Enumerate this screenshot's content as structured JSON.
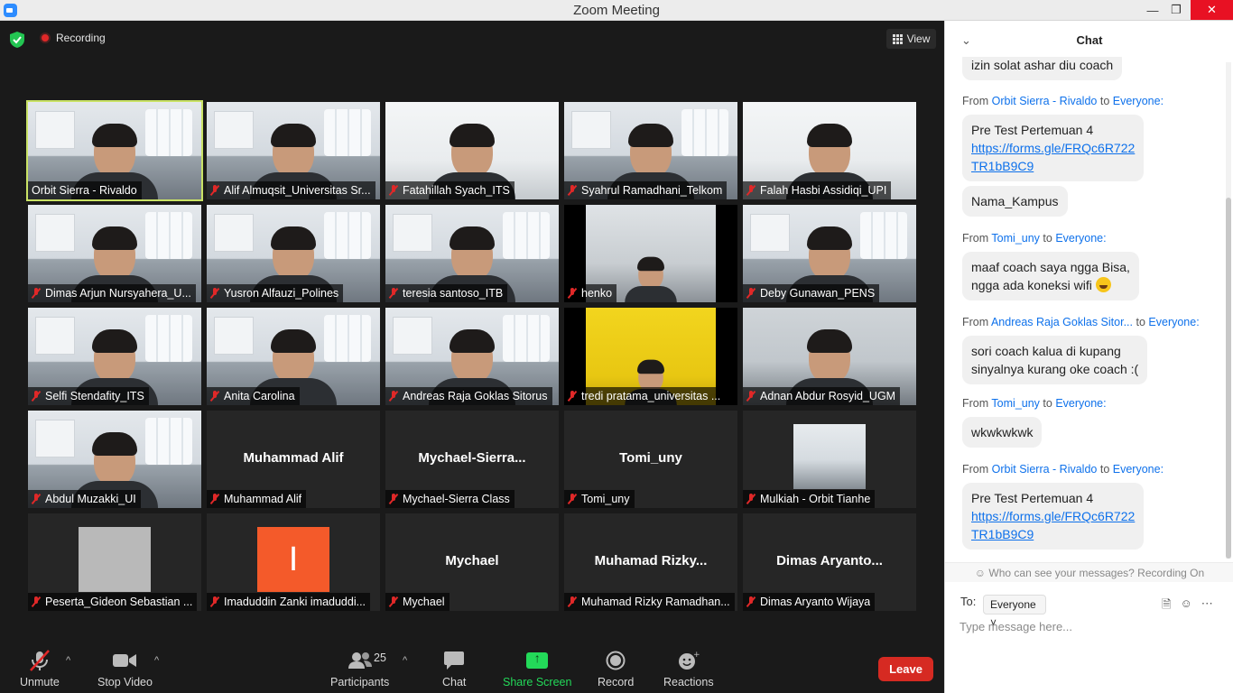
{
  "window": {
    "title": "Zoom Meeting",
    "minimize": "—",
    "maximize": "❐",
    "close": "✕"
  },
  "meeting": {
    "recording_label": "Recording",
    "view_label": "View"
  },
  "tiles": [
    {
      "name": "Orbit Sierra - Rivaldo",
      "active": true,
      "muted": false,
      "kind": "video"
    },
    {
      "name": "Alif Almuqsit_Universitas Sr...",
      "muted": true,
      "kind": "video"
    },
    {
      "name": "Fatahillah Syach_ITS",
      "muted": true,
      "kind": "video"
    },
    {
      "name": "Syahrul Ramadhani_Telkom",
      "muted": true,
      "kind": "video"
    },
    {
      "name": "Falah Hasbi Assidiqi_UPI",
      "muted": true,
      "kind": "video"
    },
    {
      "name": "Dimas Arjun Nursyahera_U...",
      "muted": true,
      "kind": "video"
    },
    {
      "name": "Yusron Alfauzi_Polines",
      "muted": true,
      "kind": "video"
    },
    {
      "name": "teresia santoso_ITB",
      "muted": true,
      "kind": "video"
    },
    {
      "name": "henko",
      "muted": true,
      "kind": "video"
    },
    {
      "name": "Deby Gunawan_PENS",
      "muted": true,
      "kind": "video"
    },
    {
      "name": "Selfi Stendafity_ITS",
      "muted": true,
      "kind": "video"
    },
    {
      "name": "Anita Carolina",
      "muted": true,
      "kind": "video"
    },
    {
      "name": "Andreas Raja Goklas Sitorus",
      "muted": true,
      "kind": "video"
    },
    {
      "name": "tredi pratama_universitas ...",
      "muted": true,
      "kind": "video"
    },
    {
      "name": "Adnan Abdur Rosyid_UGM",
      "muted": true,
      "kind": "video"
    },
    {
      "name": "Abdul Muzakki_UI",
      "muted": true,
      "kind": "video"
    },
    {
      "name": "Muhammad Alif",
      "display": "Muhammad Alif",
      "muted": true,
      "kind": "name"
    },
    {
      "name": "Mychael-Sierra Class",
      "display": "Mychael-Sierra...",
      "muted": true,
      "kind": "name"
    },
    {
      "name": "Tomi_uny",
      "display": "Tomi_uny",
      "muted": true,
      "kind": "name"
    },
    {
      "name": "Mulkiah - Orbit Tianhe",
      "muted": true,
      "kind": "small-video"
    },
    {
      "name": "Peserta_Gideon Sebastian ...",
      "muted": true,
      "kind": "avatar-gray"
    },
    {
      "name": "Imaduddin Zanki imaduddi...",
      "avatar_letter": "I",
      "muted": true,
      "kind": "avatar-orange"
    },
    {
      "name": "Mychael",
      "display": "Mychael",
      "muted": true,
      "kind": "name"
    },
    {
      "name": "Muhamad Rizky Ramadhan...",
      "display": "Muhamad  Rizky...",
      "muted": true,
      "kind": "name"
    },
    {
      "name": "Dimas Aryanto Wijaya",
      "display": "Dimas  Aryanto...",
      "muted": true,
      "kind": "name"
    }
  ],
  "toolbar": {
    "unmute": "Unmute",
    "stop_video": "Stop Video",
    "participants": "Participants",
    "participant_count": "25",
    "chat": "Chat",
    "share_screen": "Share Screen",
    "record": "Record",
    "reactions": "Reactions",
    "leave": "Leave"
  },
  "chat": {
    "title": "Chat",
    "messages": [
      {
        "text": "izin solat ashar diu coach"
      },
      {
        "from_prefix": "From",
        "sender": "Orbit Sierra - Rivaldo",
        "to_word": "to",
        "recipient": "Everyone:",
        "text": "Pre Test Pertemuan 4",
        "link": "https://forms.gle/FRQc6R722TR1bB9C9",
        "link_line1": "https://forms.gle/FRQc6R722",
        "link_line2": "TR1bB9C9"
      },
      {
        "text": "Nama_Kampus"
      },
      {
        "from_prefix": "From",
        "sender": "Tomi_uny",
        "to_word": "to",
        "recipient": "Everyone:",
        "text_line1": "maaf coach saya ngga Bisa,",
        "text_line2": "ngga ada koneksi wifi",
        "emoji": "grinning-emoji"
      },
      {
        "from_prefix": "From",
        "sender": "Andreas Raja Goklas Sitor...",
        "to_word": "to",
        "recipient": "Everyone:",
        "text_line1": "sori coach kalua di kupang",
        "text_line2": "sinyalnya kurang oke coach :("
      },
      {
        "from_prefix": "From",
        "sender": "Tomi_uny",
        "to_word": "to",
        "recipient": "Everyone:",
        "text": "wkwkwkwk"
      },
      {
        "from_prefix": "From",
        "sender": "Orbit Sierra - Rivaldo",
        "to_word": "to",
        "recipient": "Everyone:",
        "text": "Pre Test Pertemuan 4",
        "link_line1": "https://forms.gle/FRQc6R722",
        "link_line2": "TR1bB9C9"
      }
    ],
    "privacy_notice": "Who can see your messages? Recording On",
    "to_label": "To:",
    "recipient_select": "Everyone",
    "input_placeholder": "Type message here..."
  },
  "colors": {
    "accent": "#0e71eb",
    "leave": "#d62a22",
    "share": "#23d959",
    "active_speaker": "#c9e265"
  }
}
